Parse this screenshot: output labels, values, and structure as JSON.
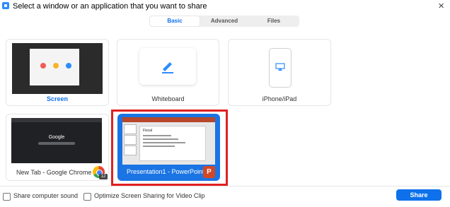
{
  "window": {
    "title": "Select a window or an application that you want to share",
    "close_glyph": "×"
  },
  "tabs": [
    {
      "label": "Basic"
    },
    {
      "label": "Advanced"
    },
    {
      "label": "Files"
    }
  ],
  "tiles": {
    "screen": "Screen",
    "whiteboard": "Whiteboard",
    "iphone": "iPhone/iPad",
    "chrome": "New Tab - Google Chrome",
    "powerpoint": "Presentation1 - PowerPoint"
  },
  "chrome_thumb": {
    "logo_text": "Google"
  },
  "ppt_thumb": {
    "slide_title": "Fiscal",
    "ppt_icon_letter": "P"
  },
  "chrome_badge": "12",
  "options": {
    "computer_sound": "Share computer sound",
    "optimize_video": "Optimize Screen Sharing for Video Clip"
  },
  "share_label": "Share",
  "colors": {
    "accent": "#0e71eb",
    "selected_tile": "#1b74e4",
    "highlight": "#e02020"
  }
}
